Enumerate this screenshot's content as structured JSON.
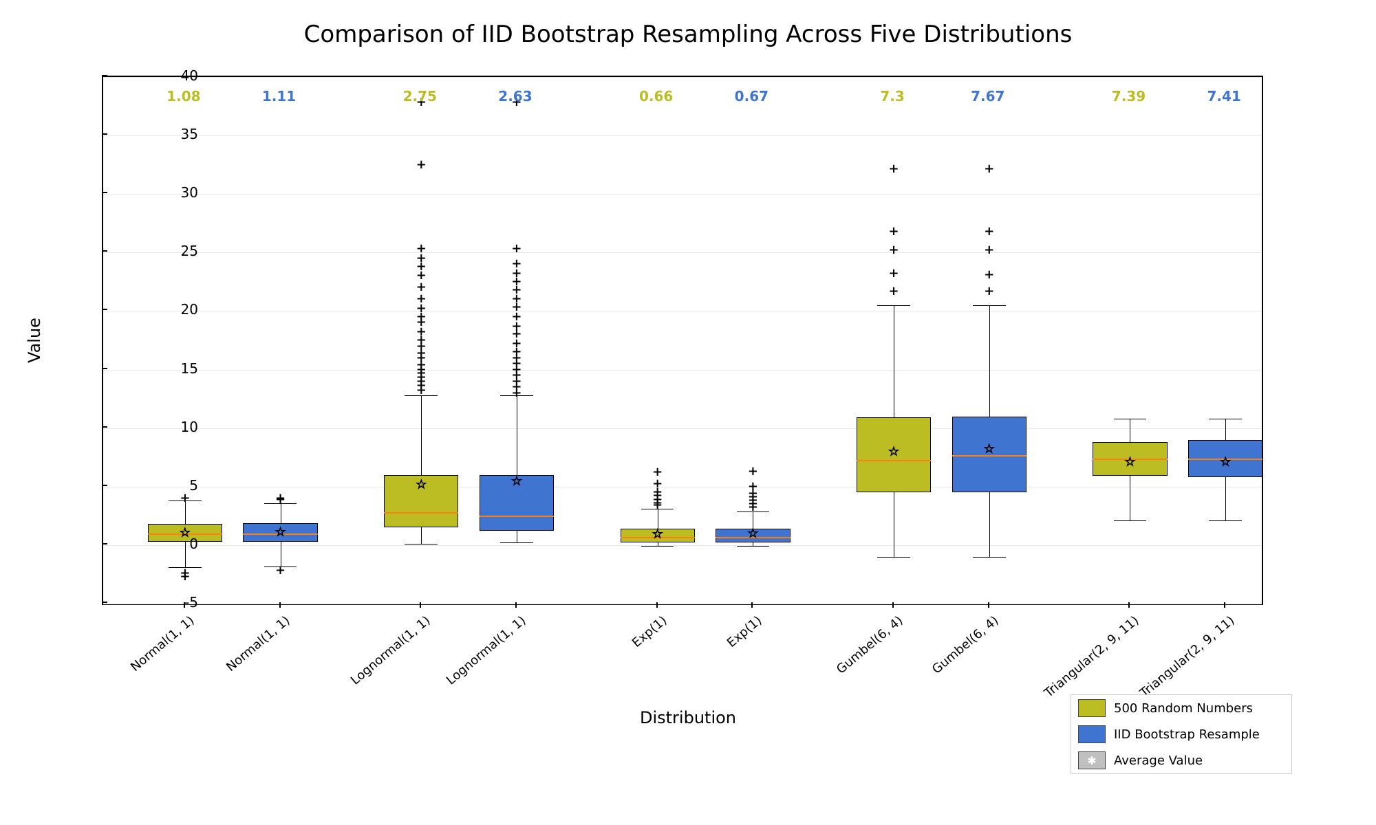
{
  "chart_data": {
    "type": "boxplot",
    "title": "Comparison of IID Bootstrap Resampling Across Five Distributions",
    "xlabel": "Distribution",
    "ylabel": "Value",
    "ylim": [
      -5,
      40
    ],
    "yticks": [
      -5,
      0,
      5,
      10,
      15,
      20,
      25,
      30,
      35,
      40
    ],
    "categories": [
      "Normal(1, 1)",
      "Normal(1, 1)",
      "Lognormal(1, 1)",
      "Lognormal(1, 1)",
      "Exp(1)",
      "Exp(1)",
      "Gumbel(6, 4)",
      "Gumbel(6, 4)",
      "Triangular(2, 9, 11)",
      "Triangular(2, 9, 11)"
    ],
    "series_group": [
      "orig",
      "resample",
      "orig",
      "resample",
      "orig",
      "resample",
      "orig",
      "resample",
      "orig",
      "resample"
    ],
    "top_annotations": [
      "1.08",
      "1.11",
      "2.75",
      "2.63",
      "0.66",
      "0.67",
      "7.3",
      "7.67",
      "7.39",
      "7.41"
    ],
    "legend": [
      {
        "label": "500 Random Numbers",
        "color": "#bcbd22"
      },
      {
        "label": "IID Bootstrap Resample",
        "color": "#3f74d1"
      },
      {
        "label": "Average Value",
        "symbol": "star",
        "color": "#c0c0c0"
      }
    ],
    "boxes": [
      {
        "q1": 0.3,
        "median": 1.0,
        "q3": 1.8,
        "wlow": -1.9,
        "whigh": 3.8,
        "mean": 1.08,
        "color": "#bcbd22",
        "fliers": [
          -2.7,
          -2.4,
          4.0
        ]
      },
      {
        "q1": 0.3,
        "median": 1.0,
        "q3": 1.9,
        "wlow": -1.8,
        "whigh": 3.6,
        "mean": 1.11,
        "color": "#3f74d1",
        "fliers": [
          -2.2,
          3.9,
          4.0
        ]
      },
      {
        "q1": 1.5,
        "median": 2.8,
        "q3": 6.0,
        "wlow": 0.1,
        "whigh": 12.8,
        "mean": 5.15,
        "color": "#bcbd22",
        "fliers": [
          13.2,
          13.6,
          14.0,
          14.3,
          14.7,
          15.0,
          15.4,
          16.0,
          16.4,
          17.0,
          17.5,
          18.2,
          19.0,
          19.5,
          20.2,
          21.0,
          22.0,
          23.0,
          23.8,
          24.5,
          25.3,
          32.5,
          37.8
        ]
      },
      {
        "q1": 1.2,
        "median": 2.5,
        "q3": 6.0,
        "wlow": 0.2,
        "whigh": 12.8,
        "mean": 5.43,
        "color": "#3f74d1",
        "fliers": [
          13.0,
          13.5,
          14.0,
          14.5,
          15.0,
          15.5,
          16.0,
          16.5,
          17.2,
          18.0,
          18.7,
          19.5,
          20.3,
          21.0,
          21.8,
          22.5,
          23.2,
          24.0,
          25.3,
          37.8
        ]
      },
      {
        "q1": 0.2,
        "median": 0.7,
        "q3": 1.4,
        "wlow": -0.05,
        "whigh": 3.1,
        "mean": 0.96,
        "color": "#bcbd22",
        "fliers": [
          3.4,
          3.6,
          3.9,
          4.2,
          4.5,
          5.2,
          6.2
        ]
      },
      {
        "q1": 0.2,
        "median": 0.7,
        "q3": 1.4,
        "wlow": -0.05,
        "whigh": 2.9,
        "mean": 0.97,
        "color": "#3f74d1",
        "fliers": [
          3.2,
          3.5,
          3.8,
          4.1,
          4.4,
          5.0,
          6.3
        ]
      },
      {
        "q1": 4.5,
        "median": 7.3,
        "q3": 10.9,
        "wlow": -1.0,
        "whigh": 20.5,
        "mean": 8.0,
        "color": "#bcbd22",
        "fliers": [
          21.7,
          23.2,
          25.2,
          26.8,
          32.1
        ]
      },
      {
        "q1": 4.5,
        "median": 7.7,
        "q3": 11.0,
        "wlow": -1.0,
        "whigh": 20.5,
        "mean": 8.2,
        "color": "#3f74d1",
        "fliers": [
          21.7,
          23.1,
          25.2,
          26.8,
          32.1
        ]
      },
      {
        "q1": 5.9,
        "median": 7.4,
        "q3": 8.8,
        "wlow": 2.1,
        "whigh": 10.8,
        "mean": 7.09,
        "color": "#bcbd22",
        "fliers": []
      },
      {
        "q1": 5.8,
        "median": 7.4,
        "q3": 9.0,
        "wlow": 2.1,
        "whigh": 10.8,
        "mean": 7.11,
        "color": "#3f74d1",
        "fliers": []
      }
    ]
  }
}
